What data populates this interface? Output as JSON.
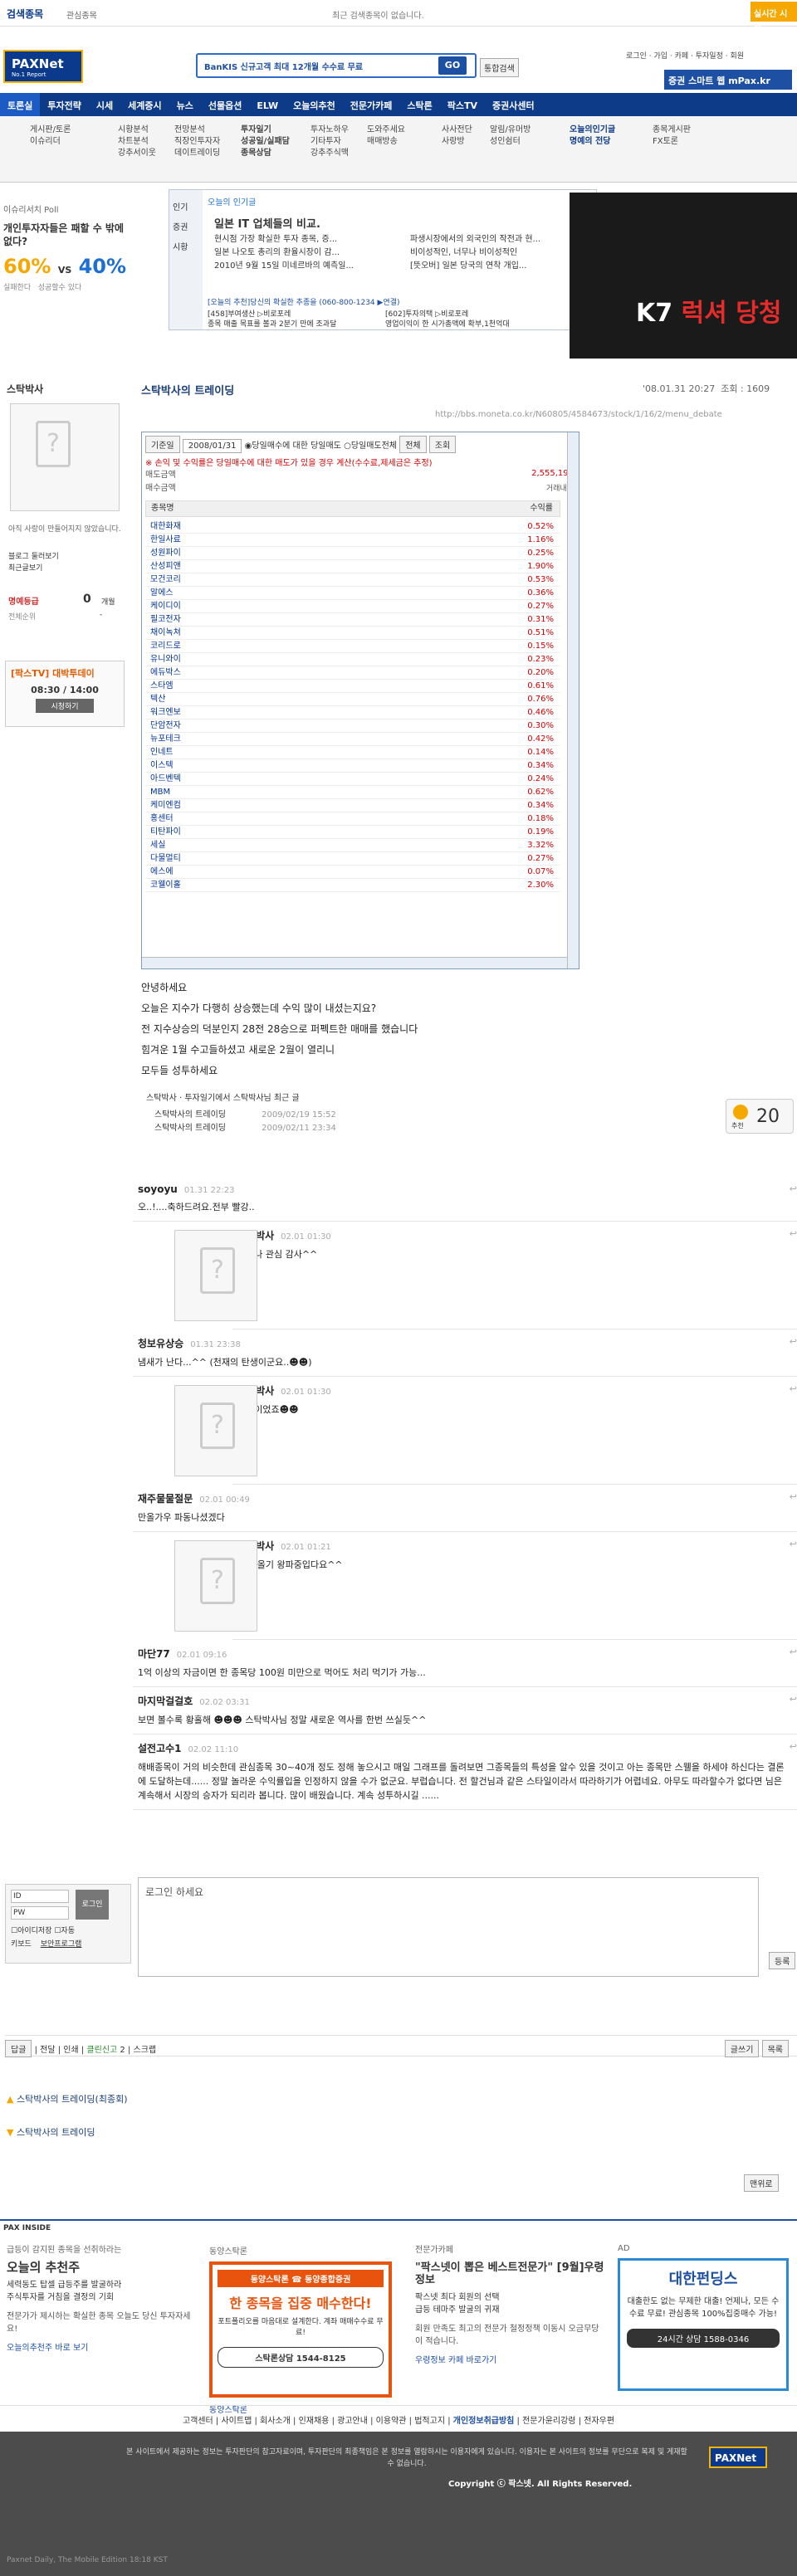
{
  "topbar": {
    "brand": "검색종목",
    "sub": "관심종목",
    "recent": "최근 검색종목이 없습니다.",
    "promo": "실시간 시세"
  },
  "header": {
    "logo": "PAXNet",
    "logo_sub": "No.1 Report",
    "search_placeholder": "BanKIS 신규고객 최대 12개월 수수료 무료",
    "go": "GO",
    "combined": "통합검색",
    "links": [
      "로그인",
      "가입",
      "카페",
      "투자일정",
      "회원"
    ],
    "mpax": "증권 스마트 웹 mPax.kr"
  },
  "nav": [
    "토론실",
    "투자전략",
    "시세",
    "세계증시",
    "뉴스",
    "선물옵션",
    "ELW",
    "오늘의추천",
    "전문가카페",
    "스탁론",
    "팍스TV",
    "증권사센터"
  ],
  "subnav": [
    [
      "게시판/토론",
      "이슈리더"
    ],
    [
      "시황분석",
      "차트분석",
      "강추서이웃"
    ],
    [
      "전망분석",
      "직장인투자자",
      "데이트레이딩"
    ],
    [
      "투자일기",
      "성공일/실패담",
      "종목상담"
    ],
    [
      "투자노하우",
      "기타투자",
      "강추주식맥"
    ],
    [
      "도와주세요",
      "매매방송"
    ],
    [
      "사사전단",
      "사랑방"
    ],
    [
      "알림/유머방",
      "성인쉼터"
    ],
    [
      "오늘의인기글",
      "명예의 전당"
    ],
    [
      "종목게시판",
      "FX토론"
    ]
  ],
  "sidebar": {
    "poll_label": "이슈리서치 Poll",
    "poll_q": "개인투자자들은 패할 수 밖에 없다?",
    "pct_a": "60%",
    "pct_b": "40%",
    "label_a": "실패한다",
    "label_b": "성공할수 있다",
    "profile_name": "스탁박사",
    "profile_note": "아직 사랑이 만들어지지 않았습니다.",
    "blog": "블로그 둘러보기",
    "recent": "최근글보기",
    "grade_label": "명예등급",
    "grade": "0",
    "grade_unit": "개월",
    "rank_label": "전체순위",
    "rank": "-",
    "tv": "[팍스TV] 대박투데이",
    "tv_time": "08:30 / 14:00",
    "tv_btn": "시청하기"
  },
  "panel": {
    "tab": "오늘의 인기글",
    "side": [
      "인기",
      "증권",
      "시황"
    ],
    "headline": "일본 IT 업체들의 비교.",
    "items": [
      "현시점 가장 확실한 투자 종목, 증...",
      "일본 나오토 총리의 환율시장이 감...",
      "2010년 9월 15일 미네르바의 예측일..."
    ],
    "items2": [
      "파생시장에서의 외국인의 작전과 현...",
      "비이성적인, 너무나 비이성적인",
      "[뜻오버] 일본 당국의 연착 개입..."
    ],
    "promo": "[오늘의 추천]당신의 확실한 추종을 (060-800-1234 ▶연결)",
    "p1": "[458]부여생산 ▷비로포레",
    "p2": "[602]투자의택 ▷비로포레",
    "p1d": "종목 매출 목표를 볼과 2분기 만에 조과달",
    "p2d": "영업이익이 한 시가총액에 확부,1천억대"
  },
  "ad": {
    "brand": "K7",
    "text": "럭셔 당청"
  },
  "post": {
    "author": "스탁박사",
    "title": "스탁박사의 트레이딩",
    "date": "'08.01.31 20:27",
    "hits_label": "조회",
    "hits": "1609",
    "url": "http://bbs.moneta.co.kr/N60805/4584673/stock/1/16/2/menu_debate",
    "body": [
      "안녕하세요",
      "오늘은 지수가 다행히 상승했는데 수익 많이 내셨는지요?",
      "전 지수상승의 덕분인지 28전 28승으로 퍼펙트한 매매를 했습니다",
      "힘겨운 1월 수고들하셨고 새로운 2월이 열리니",
      "모두들 성투하세요"
    ],
    "more_title": "투자일기에서 스탁박사님 최근 글",
    "more": [
      [
        "스탁박사의 트레이딩",
        "2009/02/19 15:52"
      ],
      [
        "스탁박사의 트레이딩",
        "2009/02/11 23:34"
      ]
    ],
    "recommend": "20",
    "recommend_label": "추천"
  },
  "frame": {
    "label": "기준일",
    "date": "2008/01/31",
    "opt1": "당일매수에 대한 당일매도",
    "opt2": "당일매도전체",
    "select": "전체",
    "btn": "조회",
    "warn": "※ 손익 및 수익률은 당일매수에 대한 매도가 있을 경우 계산(수수료,제세금은 추정)",
    "row1": "매도금액",
    "row2": "매수금액",
    "col_name": "종목명",
    "col_pct": "수익률",
    "total": "2,555,191",
    "sub_label": "거래내역",
    "rows": [
      [
        "대한화재",
        "0.52%"
      ],
      [
        "한일사료",
        "1.16%"
      ],
      [
        "성원파이",
        "0.25%"
      ],
      [
        "산성피앤",
        "1.90%"
      ],
      [
        "모건코리",
        "0.53%"
      ],
      [
        "알에스",
        "0.36%"
      ],
      [
        "케이디이",
        "0.27%"
      ],
      [
        "필코전자",
        "0.31%"
      ],
      [
        "채이녹쳐",
        "0.51%"
      ],
      [
        "코리드로",
        "0.15%"
      ],
      [
        "유니와이",
        "0.23%"
      ],
      [
        "에듀박스",
        "0.20%"
      ],
      [
        "스타엠",
        "0.61%"
      ],
      [
        "텍산",
        "0.76%"
      ],
      [
        "워크엔보",
        "0.46%"
      ],
      [
        "단암전자",
        "0.30%"
      ],
      [
        "뉴포테크",
        "0.42%"
      ],
      [
        "인네트",
        "0.14%"
      ],
      [
        "이스텍",
        "0.34%"
      ],
      [
        "아드벤텍",
        "0.24%"
      ],
      [
        "MBM",
        "0.62%"
      ],
      [
        "케미엔컴",
        "0.34%"
      ],
      [
        "홍센터",
        "0.18%"
      ],
      [
        "티탄파이",
        "0.19%"
      ],
      [
        "세실",
        "3.32%"
      ],
      [
        "다물멀티",
        "0.27%"
      ],
      [
        "에스에",
        "0.07%"
      ],
      [
        "코웰이홀",
        "2.30%"
      ]
    ]
  },
  "comments": [
    {
      "nick": "soyoyu",
      "time": "01.31 22:23",
      "text": "오..!....축하드려요.전부 빨강..",
      "avatar": false
    },
    {
      "nick": "스탁박사",
      "time": "02.01 01:30",
      "text": "언제나 관심 감사^^",
      "avatar": true
    },
    {
      "nick": "청보유상승",
      "time": "01.31 23:38",
      "text": "냄새가 난다...^^ (천재의 탄생이군요..☻☻)",
      "avatar": false
    },
    {
      "nick": "스탁박사",
      "time": "02.01 01:30",
      "text": "운빨이었죠☻☻",
      "avatar": true
    },
    {
      "nick": "재주물물절문",
      "time": "02.01 00:49",
      "text": "만올가우 파동나셨겠다",
      "avatar": false
    },
    {
      "nick": "스탁박사",
      "time": "02.01 01:21",
      "text": "네 만올기 왕파중입다요^^",
      "avatar": true
    },
    {
      "nick": "마단77",
      "time": "02.01 09:16",
      "text": "1억 이상의 자금이면 한 종목당 100원 미만으로 먹어도 처리 먹기가 가능...",
      "avatar": false
    },
    {
      "nick": "마지막걸걸호",
      "time": "02.02 03:31",
      "text": "보면 볼수록 황홀해 ☻☻☻ 스탁박사님 정말 새로운 역사를 한번 쓰실듯^^",
      "avatar": false
    },
    {
      "nick": "설전고수1",
      "time": "02.02 11:10",
      "text": "해배종목이 거의 비슷한데 관심종목 30~40개 정도 정해 놓으시고 매일 그래프를 돌려보면 그종목들의 특성을 알수 있을 것이고 아는 종목만 스웰을 하세야 하신다는 결론에 도달하는데...... 정말 놀라운 수익률입을 인정하지 않을 수가 없군요. 부럽습니다. 전 할건님과 같은 스타일이라서 따라하기가 어렵네요. 아무도 따라할수가 없다면 님은 계속해서 시장의 승자가 되리라 봅니다. 많이 배웠습니다. 계속 성투하시길 ......",
      "avatar": false
    }
  ],
  "reply": {
    "login_placeholder": "로그인 하세요",
    "login_btn": "로그인",
    "id": "ID",
    "pw": "PW",
    "save": "아이디저장",
    "auto": "자동",
    "keyboard": "키보드",
    "security": "보안프로그램",
    "submit": "등록"
  },
  "actions": {
    "left": [
      "답글",
      "전달",
      "인쇄",
      "클린신고",
      "스크랩"
    ],
    "clean_count": "2",
    "right": [
      "글쓰기",
      "목록"
    ]
  },
  "related": [
    "스탁박사의 트레이딩(최종회)",
    "스탁박사의 트레이딩"
  ],
  "top_btn": "맨위로",
  "inside": {
    "label": "PAX INSIDE",
    "c1_t": "급등이 감지된 종목을 선취하라는",
    "c1_h": "오늘의 추천주",
    "c1_items": [
      "세력동도 탑셀 급등주를 발굴하라",
      "주식투자를 거침을 결정의 기회"
    ],
    "c1_note": "전문가가 제시하는 확실한 종목 오늘도 당신 투자자세요!",
    "c1_link": "오늘의추천주 바로 보기",
    "c2_t": "동양스탁론",
    "c2_brand": "동양스탁론 ☎ 동양종합증권",
    "c2_h": "한 종목을 집중 매수한다!",
    "c2_sub": "포트폴리오를 마음대로 설계한다. 계좌 매매수수료 무료!",
    "c2_tel": "스탁론상담 1544-8125",
    "c2_link": "동양스탁론",
    "c3_t": "전문가카페",
    "c3_h": "\"팍스넷이 뽑은 베스트전문가\" [9월]우령정보",
    "c3_items": [
      "팍스넷 최다 회원의 선택",
      "급등 테마주 발굴의 귀재"
    ],
    "c3_note": "회원 만족도 최고의 전문가 철정정책 이동시 오금무당이 적습니다.",
    "c3_link": "우령정보 카페 바로가기",
    "c4_t": "AD",
    "c4_h": "대한펀딩스",
    "c4_sub": "대출한도 없는 무제한 대출! 언제나, 모든 수수료 무료! 관심종목 100%집중매수 가능!",
    "c4_tel": "24시간 상담 1588-0346"
  },
  "footer": {
    "links": [
      "고객센터",
      "사이트맵",
      "회사소개",
      "인재채용",
      "광고안내",
      "이용약관",
      "법적고지",
      "개인정보취급방침",
      "전문가윤리강령",
      "전자우편"
    ],
    "disclaimer": "본 사이트에서 제공하는 정보는 투자판단의 참고자료이며, 투자판단의 최종책임은 본 정보를 열람하시는 이용자에게 있습니다. 이용자는 본 사이트의 정보를 무단으로 복제 및 게재할 수 없습니다.",
    "copyright": "Copyright ⓒ 팍스넷. All Rights Reserved.",
    "logo": "PAXNet",
    "bottom": "Paxnet Daily, The Mobile Edition 18:18 KST"
  }
}
